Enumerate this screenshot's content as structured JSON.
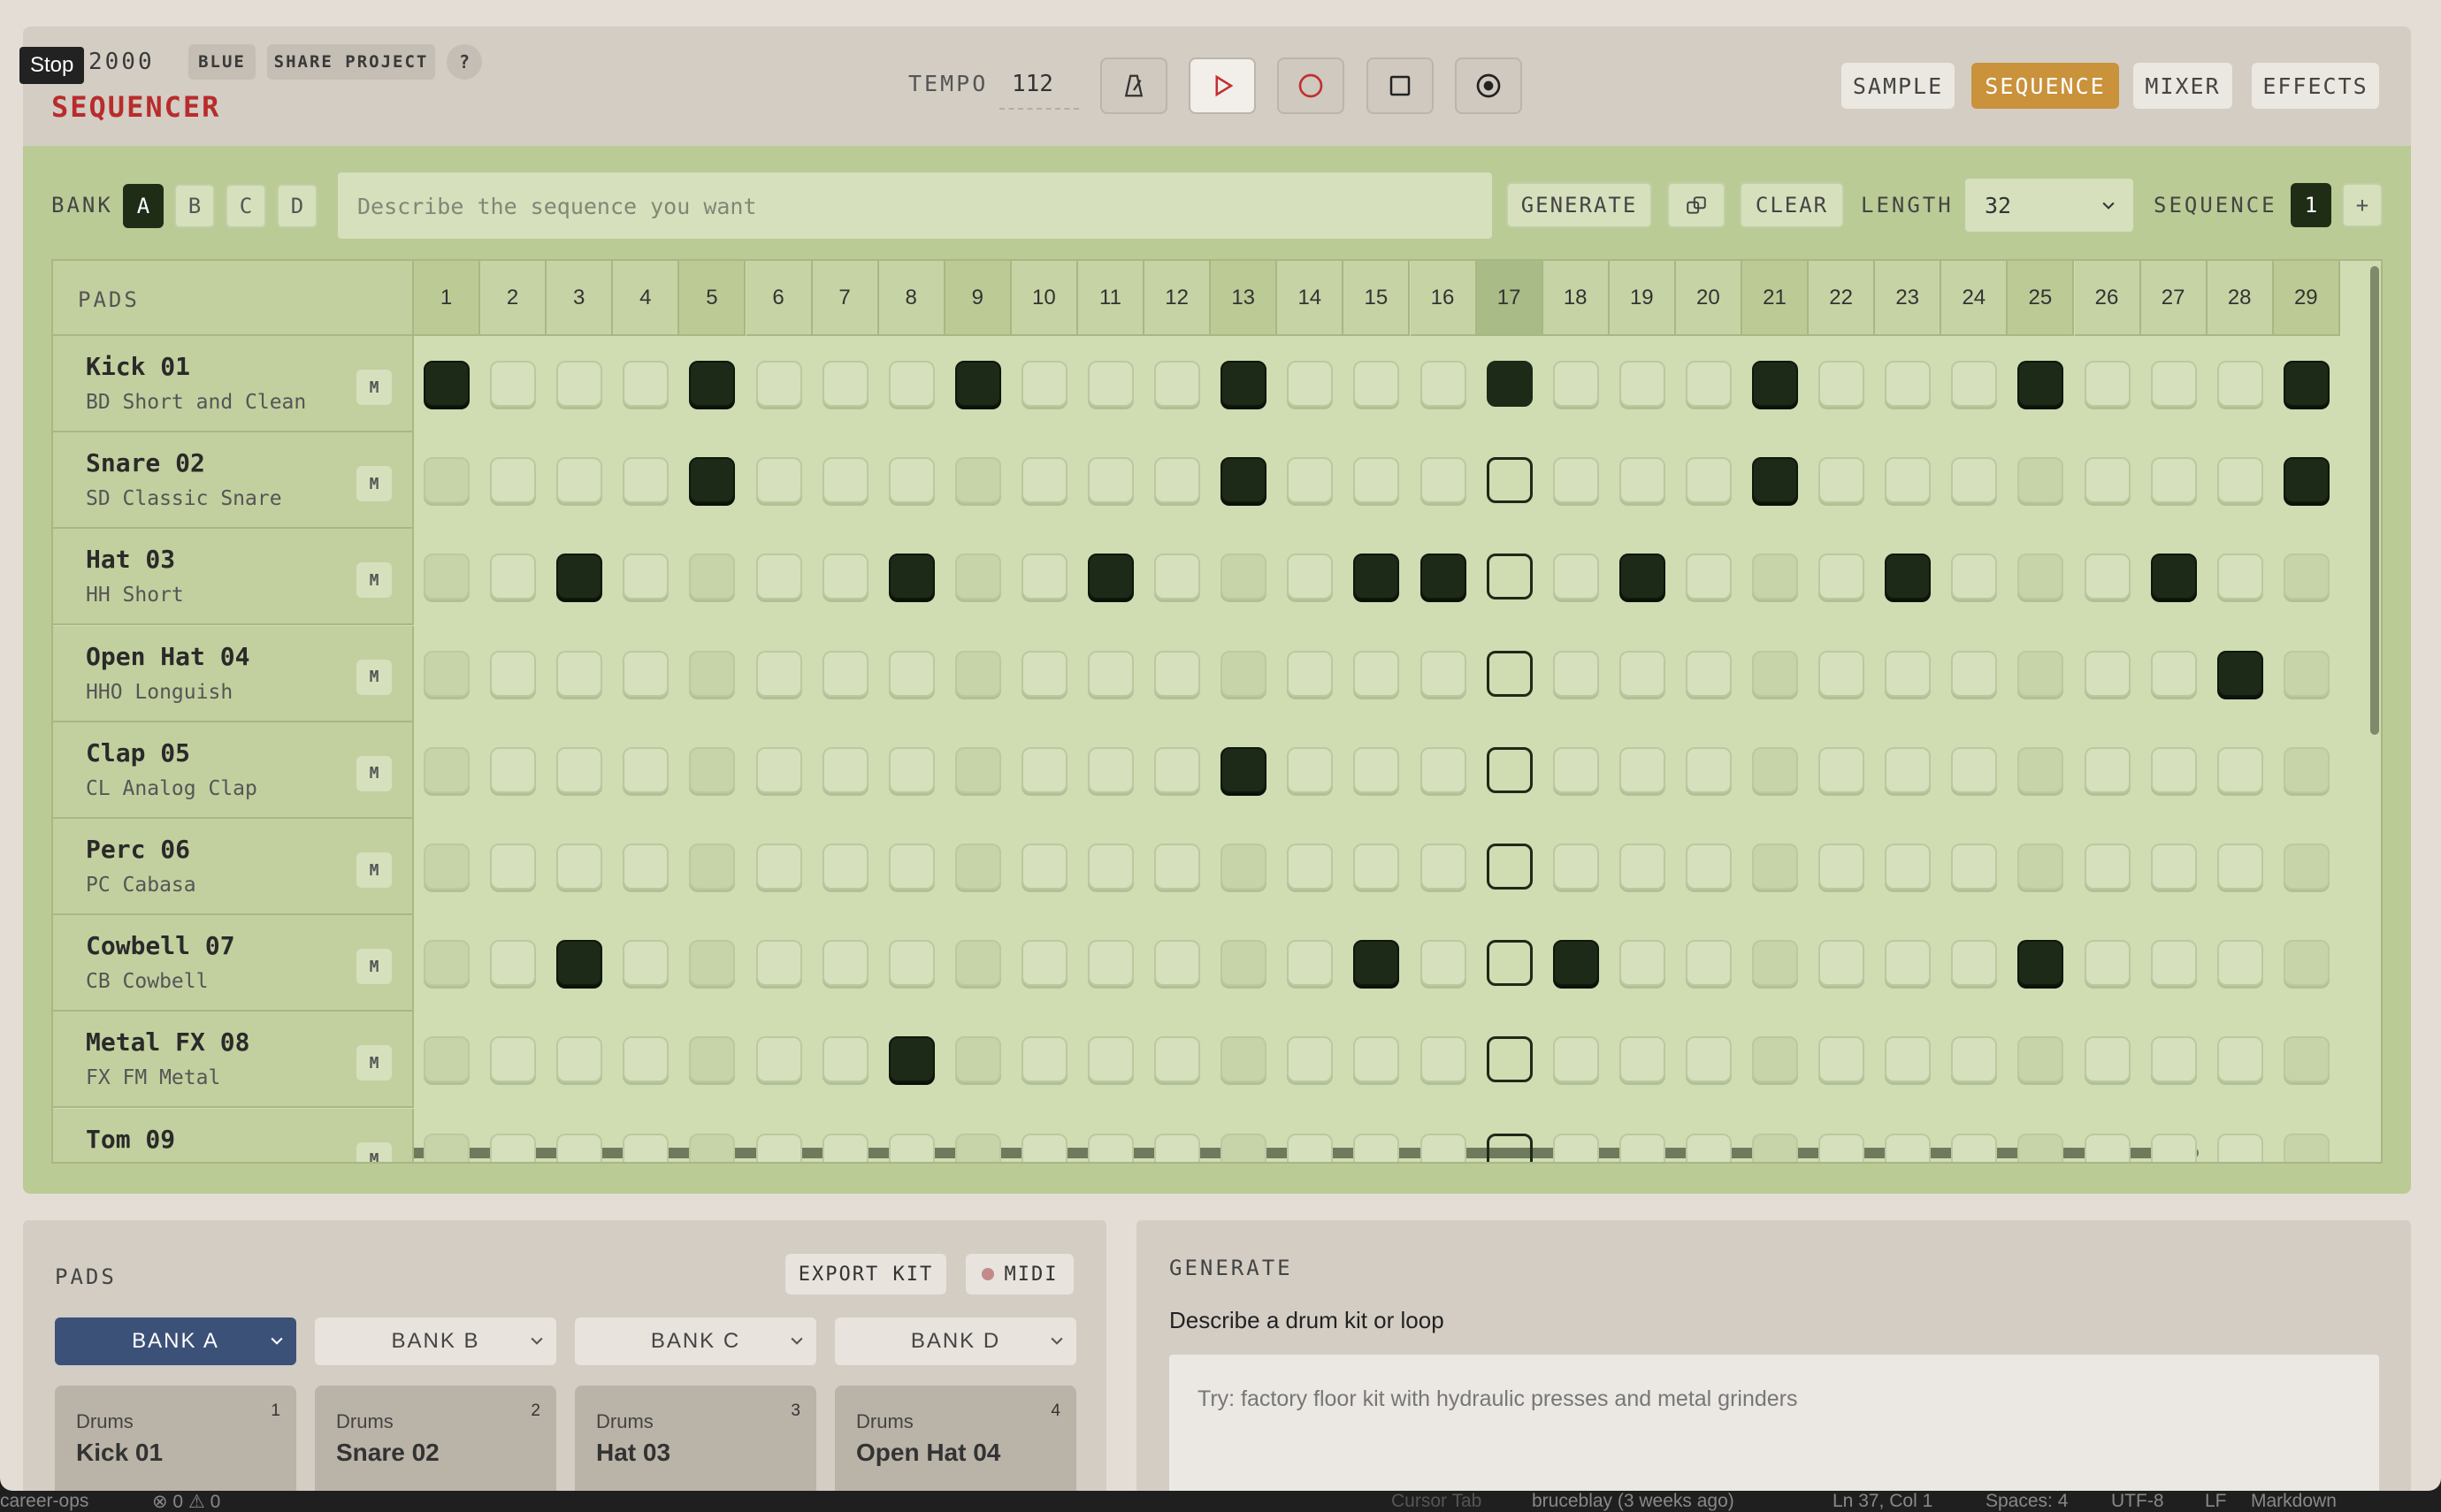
{
  "tooltip": "Stop",
  "header": {
    "brand": "2000",
    "chips": [
      "BLUE",
      "SHARE PROJECT"
    ],
    "help": "?",
    "title": "SEQUENCER",
    "tempo_label": "TEMPO",
    "tempo_value": "112",
    "nav": [
      {
        "label": "SAMPLE",
        "active": false
      },
      {
        "label": "SEQUENCE",
        "active": true
      },
      {
        "label": "MIXER",
        "active": false
      },
      {
        "label": "EFFECTS",
        "active": false
      }
    ]
  },
  "sequencer": {
    "bank_label": "BANK",
    "banks": [
      "A",
      "B",
      "C",
      "D"
    ],
    "active_bank": "A",
    "prompt_placeholder": "Describe the sequence you want",
    "generate_label": "GENERATE",
    "clear_label": "CLEAR",
    "length_label": "LENGTH",
    "length_value": "32",
    "sequence_label": "SEQUENCE",
    "sequence_value": "1",
    "add_label": "+",
    "pads_header": "PADS",
    "steps": [
      "1",
      "2",
      "3",
      "4",
      "5",
      "6",
      "7",
      "8",
      "9",
      "10",
      "11",
      "12",
      "13",
      "14",
      "15",
      "16",
      "17",
      "18",
      "19",
      "20",
      "21",
      "22",
      "23",
      "24",
      "25",
      "26",
      "27",
      "28",
      "29"
    ],
    "current_step": 17,
    "mute_label": "M",
    "tracks": [
      {
        "name": "Kick 01",
        "sample": "BD Short and Clean",
        "steps_on": [
          1,
          5,
          9,
          13,
          17,
          21,
          25,
          29
        ]
      },
      {
        "name": "Snare 02",
        "sample": "SD Classic Snare",
        "steps_on": [
          5,
          13,
          21,
          29
        ]
      },
      {
        "name": "Hat 03",
        "sample": "HH Short",
        "steps_on": [
          3,
          8,
          11,
          15,
          16,
          19,
          23,
          27
        ]
      },
      {
        "name": "Open Hat 04",
        "sample": "HHO Longuish",
        "steps_on": [
          28
        ]
      },
      {
        "name": "Clap 05",
        "sample": "CL Analog Clap",
        "steps_on": [
          13
        ]
      },
      {
        "name": "Perc 06",
        "sample": "PC Cabasa",
        "steps_on": []
      },
      {
        "name": "Cowbell 07",
        "sample": "CB Cowbell",
        "steps_on": [
          3,
          15,
          18,
          25
        ]
      },
      {
        "name": "Metal FX 08",
        "sample": "FX FM Metal",
        "steps_on": [
          8
        ]
      },
      {
        "name": "Tom 09",
        "sample": "",
        "steps_on": []
      }
    ]
  },
  "pads_panel": {
    "title": "PADS",
    "export_label": "EXPORT KIT",
    "midi_label": "MIDI",
    "bank_tabs": [
      "BANK A",
      "BANK B",
      "BANK C",
      "BANK D"
    ],
    "cards": [
      {
        "category": "Drums",
        "number": "1",
        "name": "Kick 01"
      },
      {
        "category": "Drums",
        "number": "2",
        "name": "Snare 02"
      },
      {
        "category": "Drums",
        "number": "3",
        "name": "Hat 03"
      },
      {
        "category": "Drums",
        "number": "4",
        "name": "Open Hat 04"
      }
    ]
  },
  "generate_panel": {
    "title": "GENERATE",
    "subtitle": "Describe a drum kit or loop",
    "placeholder": "Try: factory floor kit with hydraulic presses and metal grinders"
  },
  "statusbar": {
    "branch": "career-ops",
    "problems": "⊗ 0 ⚠ 0",
    "cursor_tab": "Cursor Tab",
    "blame": "bruceblay (3 weeks ago)",
    "position": "Ln 37, Col 1",
    "spaces": "Spaces: 4",
    "encoding": "UTF-8",
    "eol": "LF",
    "language": "Markdown"
  },
  "colors": {
    "accent": "#c9923b",
    "title_red": "#b82c2c",
    "step_on": "#1d2a17",
    "sequencer_bg": "#bacb95",
    "active_bank_tab": "#3c5178"
  }
}
